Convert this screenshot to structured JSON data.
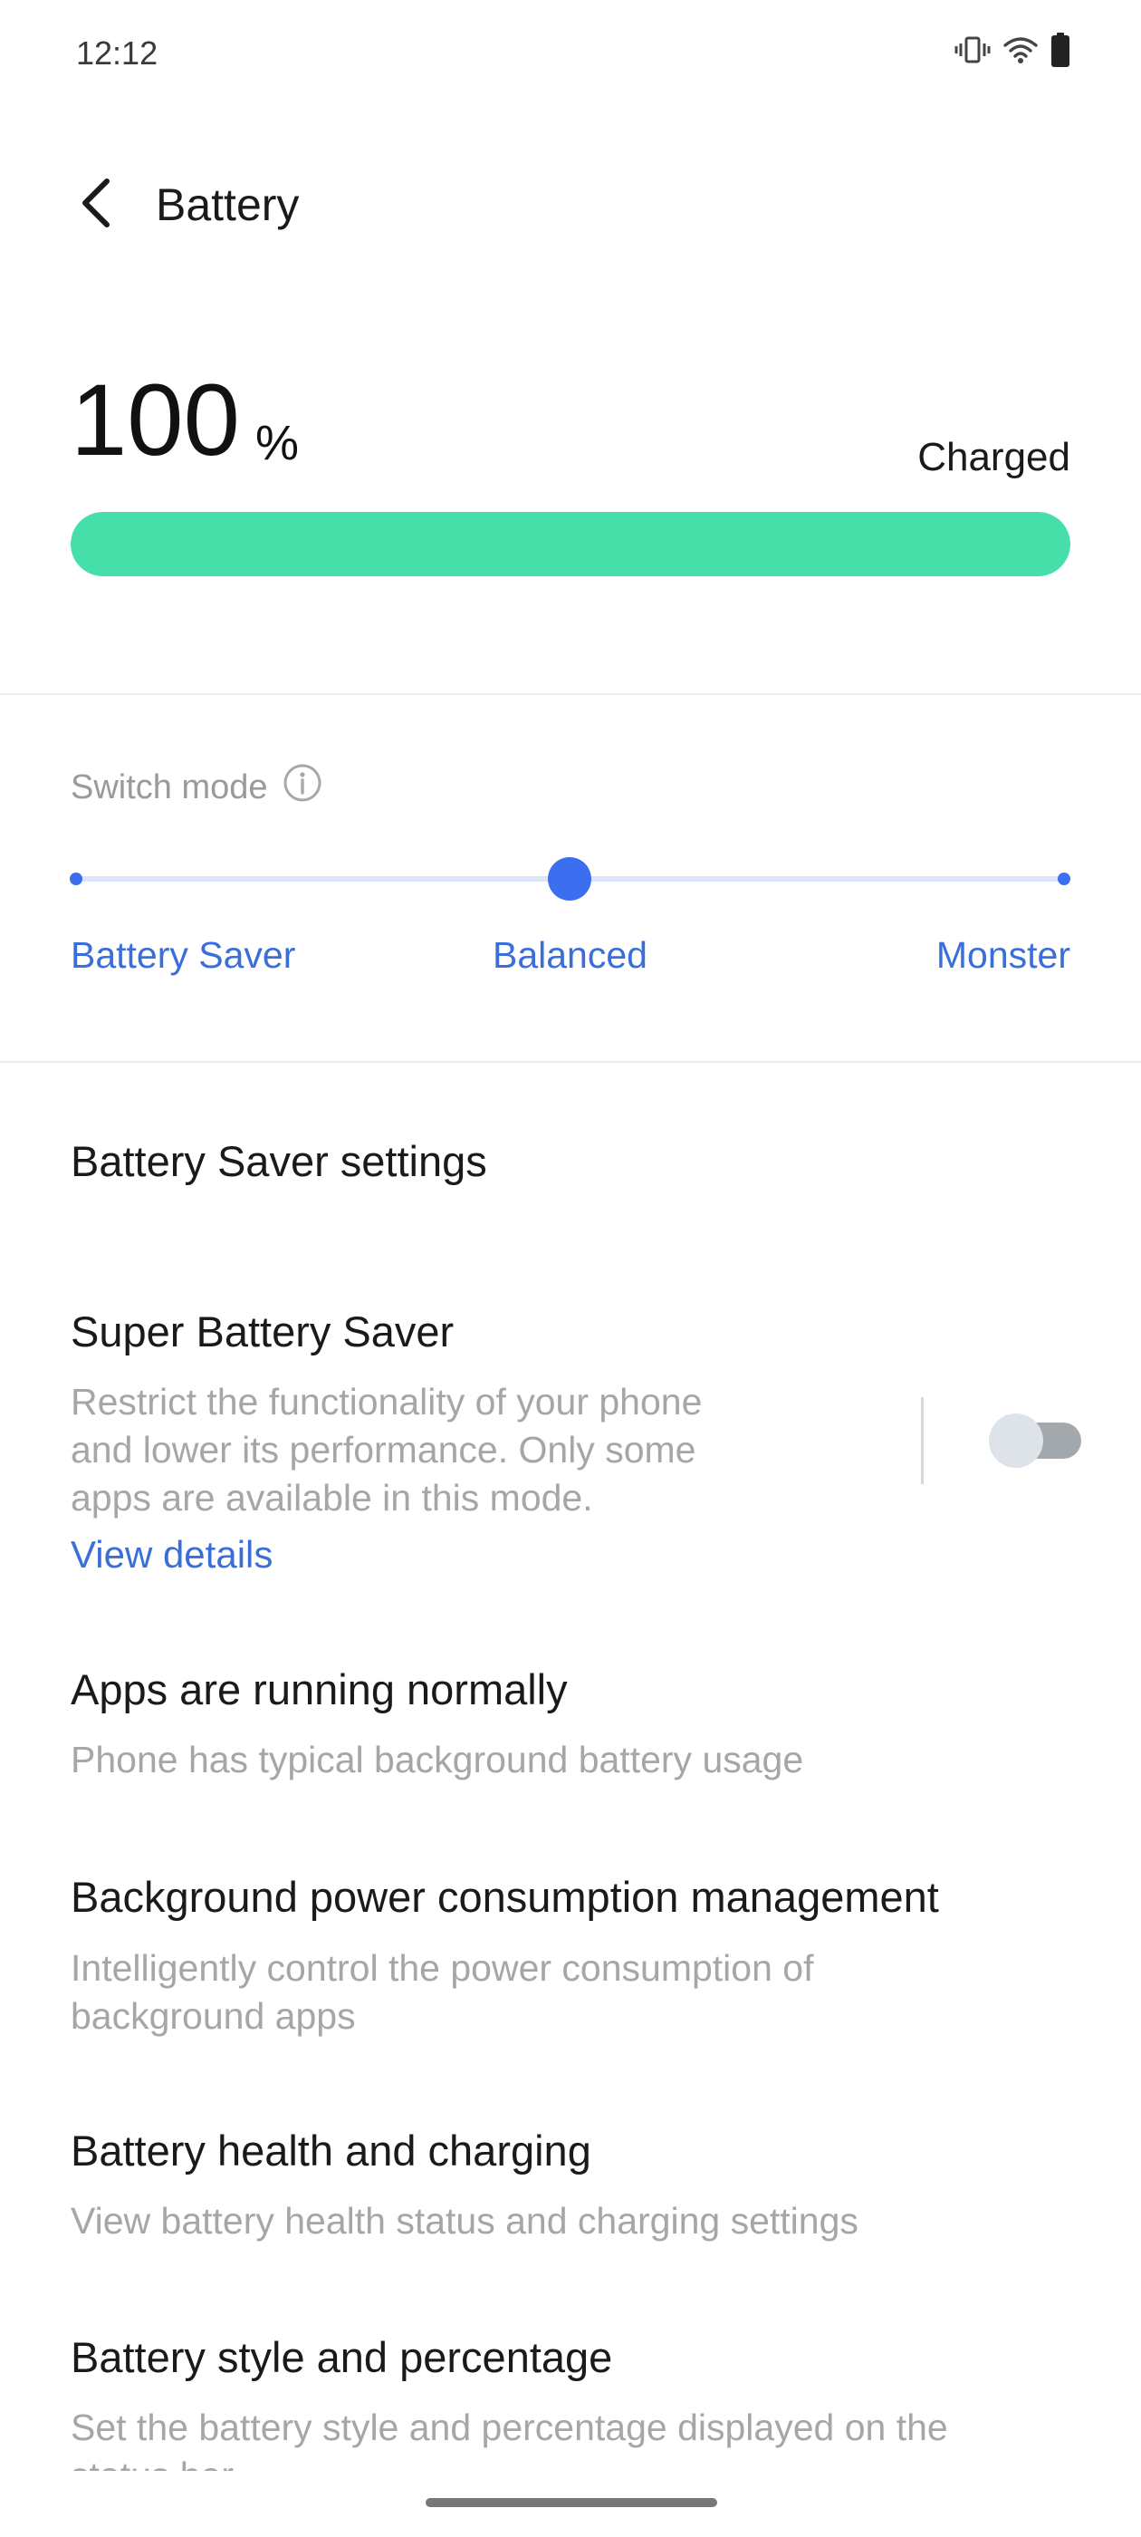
{
  "status_bar": {
    "time": "12:12",
    "icons": [
      "vibrate-icon",
      "wifi-icon",
      "battery-icon"
    ]
  },
  "header": {
    "back_icon": "chevron-left-icon",
    "title": "Battery"
  },
  "battery": {
    "level_value": "100",
    "level_unit": "%",
    "level_fraction": 1.0,
    "status": "Charged",
    "bar_color": "#46dfa9"
  },
  "mode_switch": {
    "label": "Switch mode",
    "info_icon": "info-icon",
    "options": [
      "Battery Saver",
      "Balanced",
      "Monster"
    ],
    "selected": "Balanced",
    "accent_color": "#3b6ff0"
  },
  "settings": {
    "battery_saver_settings": "Battery Saver settings",
    "super_battery_saver": {
      "title": "Super Battery Saver",
      "description_lines": [
        "Restrict the functionality of your phone",
        "and lower its performance. Only some",
        "apps are available in this mode."
      ],
      "link": "View details",
      "enabled": false
    },
    "apps_running": {
      "title": "Apps are running normally",
      "description": "Phone has typical background battery usage"
    },
    "background_power": {
      "title": "Background power consumption management",
      "description_lines": [
        "Intelligently control the power consumption of",
        "background apps"
      ]
    },
    "battery_health": {
      "title": "Battery health and charging",
      "description": "View battery health status and charging settings"
    },
    "battery_style": {
      "title": "Battery style and percentage",
      "description_lines": [
        "Set the battery style and percentage displayed on the",
        "status bar"
      ]
    }
  }
}
